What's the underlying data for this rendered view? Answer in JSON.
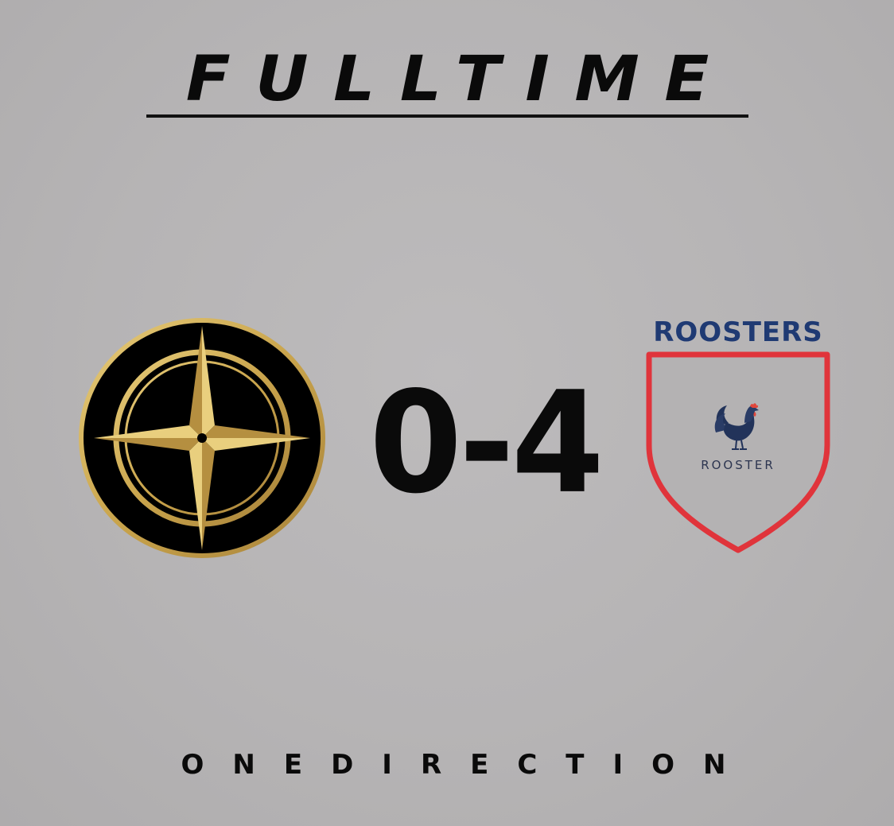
{
  "header": {
    "title": "FULLTIME"
  },
  "match": {
    "home": {
      "crest_icon": "compass-rose-icon",
      "crest_colors": {
        "ring": "#d4b25a",
        "field": "#000000"
      }
    },
    "score": "0-4",
    "away": {
      "name": "ROOSTERS",
      "crest_label": "ROOSTER",
      "crest_icon": "rooster-icon",
      "name_color": "#1f3a73",
      "shield_border_color": "#e0343b"
    }
  },
  "footer": {
    "text": "ONEDIRECTION"
  }
}
